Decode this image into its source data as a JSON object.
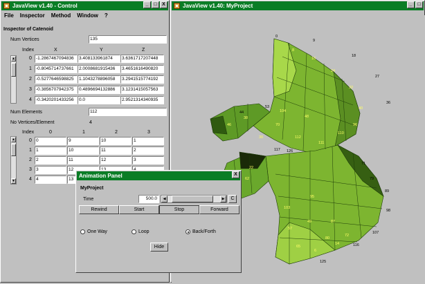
{
  "control": {
    "title": "JavaView v1.40 - Control",
    "win_buttons": [
      "_",
      "□",
      "X"
    ],
    "menu": [
      "File",
      "Inspector",
      "Method",
      "Window",
      "?"
    ],
    "inspector_heading": "Inspector of Catenoid",
    "num_vertices_label": "Num Vertices",
    "num_vertices_value": "135",
    "vertex_headers": [
      "Index",
      "X",
      "Y",
      "Z"
    ],
    "vertex_rows": [
      {
        "index": "0",
        "x": "-1.2867467094836",
        "y": "3.408133961874",
        "z": "3.6361717207448"
      },
      {
        "index": "1",
        "x": "-0.8045714737661",
        "y": "2.0008681915436",
        "z": "3.4651616490820"
      },
      {
        "index": "2",
        "x": "-0.5277646598825",
        "y": "1.1043278896058",
        "z": "3.2941515774192"
      },
      {
        "index": "3",
        "x": "-0.3856707942375",
        "y": "0.4896694132886",
        "z": "3.1231415057563"
      },
      {
        "index": "4",
        "x": "-0.3420201433256",
        "y": "0.0",
        "z": "2.9521314340935"
      }
    ],
    "num_elements_label": "Num Elements",
    "num_elements_value": "112",
    "verts_per_elem_label": "No Vertices/Element",
    "verts_per_elem_value": "4",
    "element_headers": [
      "Index",
      "0",
      "1",
      "2",
      "3"
    ],
    "element_rows": [
      {
        "index": "0",
        "c": [
          "0",
          "9",
          "10",
          "1"
        ]
      },
      {
        "index": "1",
        "c": [
          "1",
          "10",
          "11",
          "2"
        ]
      },
      {
        "index": "2",
        "c": [
          "2",
          "11",
          "12",
          "3"
        ]
      },
      {
        "index": "3",
        "c": [
          "3",
          "12",
          "13",
          "4"
        ]
      },
      {
        "index": "4",
        "c": [
          "4",
          "13",
          "14",
          "5"
        ]
      }
    ]
  },
  "animation": {
    "title": "Animation Panel",
    "close": "X",
    "project": "MyProject",
    "time_label": "Time",
    "time_value": "500.0",
    "time_button": "C",
    "time_level": 0.35,
    "buttons": [
      "Rewind",
      "Start",
      "Stop",
      "Forward"
    ],
    "modes": [
      "One Way",
      "Loop",
      "Back/Forth"
    ],
    "selected_mode": "Back/Forth",
    "hide": "Hide"
  },
  "project": {
    "title": "JavaView v1.40: MyProject",
    "win_buttons": [
      "_",
      "□"
    ],
    "vertex_labels": [
      "0",
      "9",
      "18",
      "27",
      "36",
      "44",
      "53",
      "8",
      "16",
      "24",
      "32",
      "40",
      "48",
      "71",
      "79",
      "89",
      "98",
      "107",
      "116",
      "125",
      "117",
      "126",
      "104",
      "96",
      "110",
      "111",
      "112",
      "103",
      "95",
      "87",
      "72",
      "80",
      "49",
      "57",
      "65",
      "6",
      "14",
      "22",
      "30",
      "38",
      "46",
      "54",
      "62",
      "70"
    ]
  }
}
